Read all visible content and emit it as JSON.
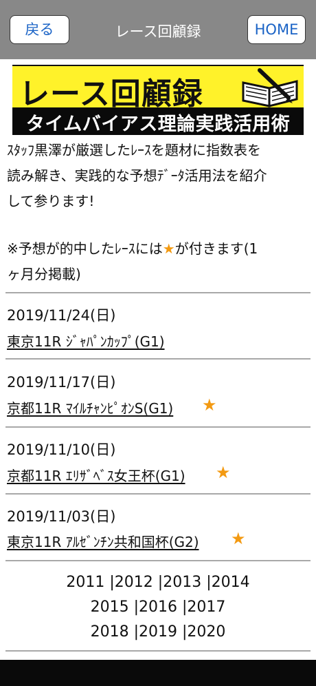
{
  "header": {
    "back_label": "戻る",
    "title": "レース回顧録",
    "home_label": "HOME",
    "bg_color": "#888888",
    "button_text_color": "#1a63c6"
  },
  "banner": {
    "title": "レース回顧録",
    "subtitle": "タイムバイアス理論実践活用術",
    "icon": "book-pen-icon",
    "accent_color": "#fff22a"
  },
  "intro": {
    "line1": "ｽﾀｯﾌ黒澤が厳選したﾚｰｽを題材に指数表を",
    "line2": "読み解き、実践的な予想ﾃﾞｰﾀ活用法を紹介",
    "line3": "して参ります!"
  },
  "notice": {
    "prefix": "※予想が的中したﾚｰｽには",
    "star": "★",
    "suffix": "が付きます(1",
    "line2": "ヶ月分掲載)"
  },
  "races": [
    {
      "date": "2019/11/24(日)",
      "link": "東京11R ｼﾞｬﾊﾟﾝｶｯﾌﾟ(G1)",
      "hit": false,
      "star": ""
    },
    {
      "date": "2019/11/17(日)",
      "link": "京都11R ﾏｲﾙﾁｬﾝﾋﾟｵﾝS(G1)",
      "hit": true,
      "star": "★"
    },
    {
      "date": "2019/11/10(日)",
      "link": "京都11R ｴﾘｻﾞﾍﾞｽ女王杯(G1)",
      "hit": true,
      "star": "★"
    },
    {
      "date": "2019/11/03(日)",
      "link": "東京11R ｱﾙｾﾞﾝﾁﾝ共和国杯(G2)",
      "hit": true,
      "star": "★"
    }
  ],
  "years": {
    "row1": [
      "2011",
      "|2012",
      "|2013",
      "|2014"
    ],
    "row2": [
      "2015",
      "|2016",
      "|2017"
    ],
    "row3": [
      "2018",
      "|2019",
      "|2020"
    ]
  },
  "colors": {
    "star": "#f39a12",
    "rule": "#a8a8a8"
  }
}
